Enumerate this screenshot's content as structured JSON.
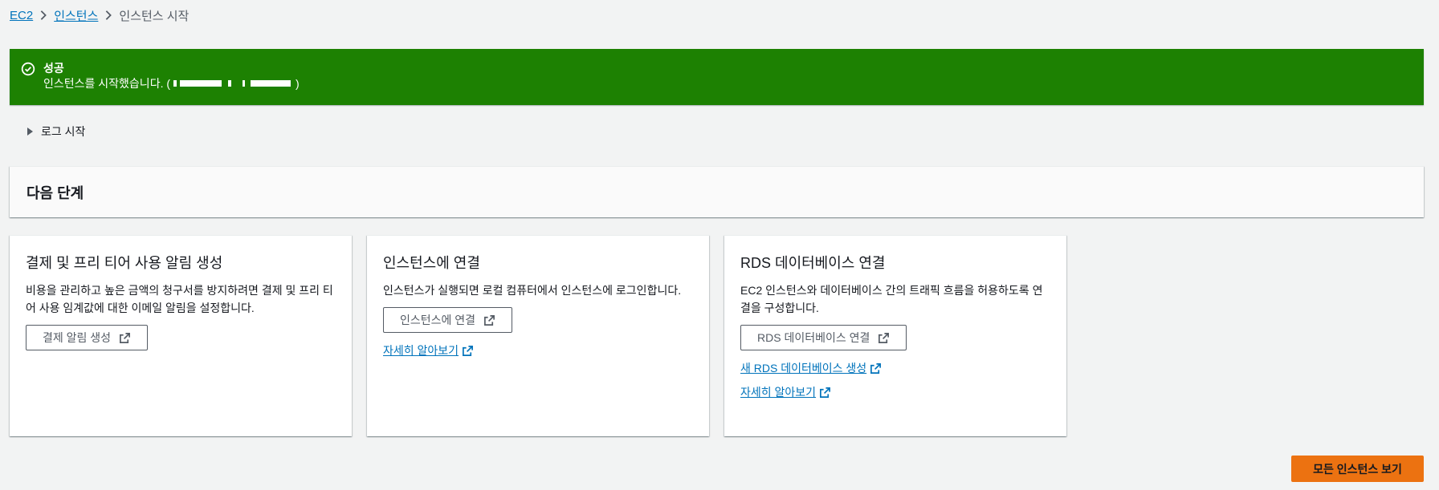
{
  "breadcrumb": {
    "items": [
      "EC2",
      "인스턴스"
    ],
    "current": "인스턴스 시작"
  },
  "flash": {
    "title": "성공",
    "message": "인스턴스를 시작했습니다. (",
    "message_end": ")"
  },
  "log_toggle": "로그 시작",
  "next_steps": {
    "title": "다음 단계"
  },
  "cards": [
    {
      "title": "결제 및 프리 티어 사용 알림 생성",
      "desc": "비용을 관리하고 높은 금액의 청구서를 방지하려면 결제 및 프리 티어 사용 임계값에 대한 이메일 알림을 설정합니다.",
      "button": "결제 알림 생성"
    },
    {
      "title": "인스턴스에 연결",
      "desc": "인스턴스가 실행되면 로컬 컴퓨터에서 인스턴스에 로그인합니다.",
      "button": "인스턴스에 연결",
      "link1": "자세히 알아보기"
    },
    {
      "title": "RDS 데이터베이스 연결",
      "desc": "EC2 인스턴스와 데이터베이스 간의 트래픽 흐름을 허용하도록 연결을 구성합니다.",
      "button": "RDS 데이터베이스 연결",
      "link1": "새 RDS 데이터베이스 생성",
      "link2": "자세히 알아보기"
    }
  ],
  "primary_button": "모든 인스턴스 보기",
  "colors": {
    "success": "#1d8102",
    "link": "#0073bb",
    "primary": "#ec7211",
    "background": "#f2f3f3"
  }
}
